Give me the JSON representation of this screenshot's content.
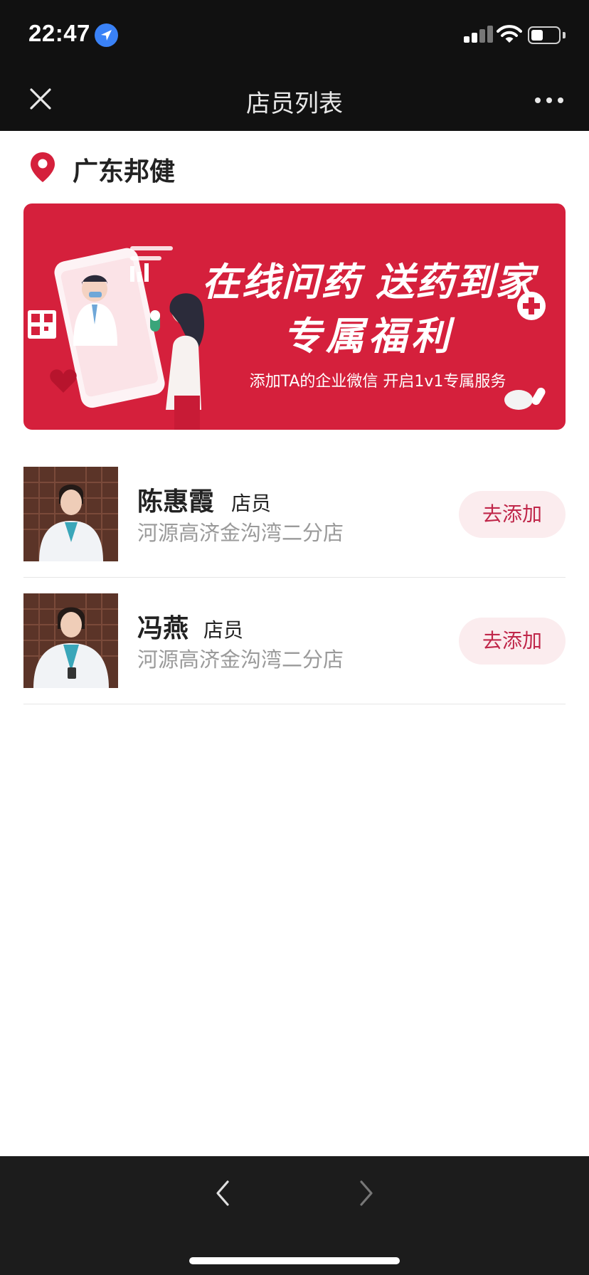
{
  "status_bar": {
    "time": "22:47",
    "location_icon": "location-arrow-icon",
    "signal_icon": "cellular-signal-icon",
    "wifi_icon": "wifi-icon",
    "battery_icon": "battery-icon",
    "battery_level": 0.45
  },
  "nav": {
    "title": "店员列表",
    "close_icon": "close-icon",
    "more_icon": "more-dots-icon"
  },
  "store": {
    "name": "广东邦健",
    "pin_icon": "location-pin-icon"
  },
  "banner": {
    "line1": "在线问药 送药到家",
    "line2": "专属福利",
    "subtitle": "添加TA的企业微信 开启1v1专属服务"
  },
  "staff": [
    {
      "name": "陈惠霞",
      "role": "店员",
      "store": "河源高济金沟湾二分店",
      "action": "去添加"
    },
    {
      "name": "冯燕",
      "role": "店员",
      "store": "河源高济金沟湾二分店",
      "action": "去添加"
    }
  ],
  "bottom": {
    "back_icon": "chevron-left-icon",
    "forward_icon": "chevron-right-icon"
  },
  "colors": {
    "accent": "#d5203c",
    "button_text": "#c0274a",
    "button_bg": "#fbecee",
    "dark_bar": "#111111"
  }
}
